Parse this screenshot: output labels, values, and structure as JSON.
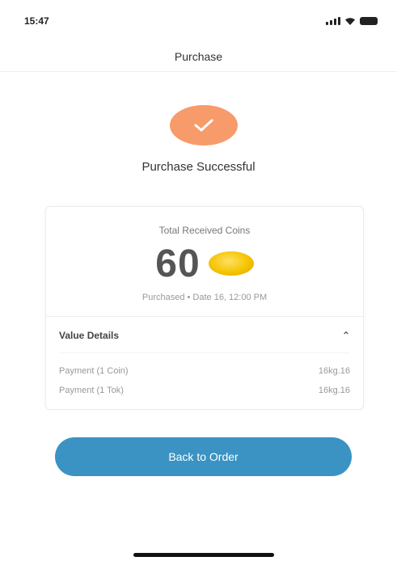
{
  "status_bar": {
    "time": "15:47"
  },
  "nav": {
    "title": "Purchase"
  },
  "success": {
    "title": "Purchase Successful",
    "badge_color": "#f79b6a"
  },
  "card": {
    "caption": "Total Received Coins",
    "amount": "60",
    "coin_icon": "gold-coin",
    "purchase_time": "Purchased • Date 16, 12:00 PM",
    "details": {
      "header": "Value Details",
      "toggle_icon": "chevron-up",
      "rows": [
        {
          "label": "Payment (1 Coin)",
          "value": "16kg.16"
        },
        {
          "label": "Payment (1 Tok)",
          "value": "16kg.16"
        }
      ]
    }
  },
  "actions": {
    "primary_label": "Back to Order",
    "primary_color": "#3a93c3"
  }
}
